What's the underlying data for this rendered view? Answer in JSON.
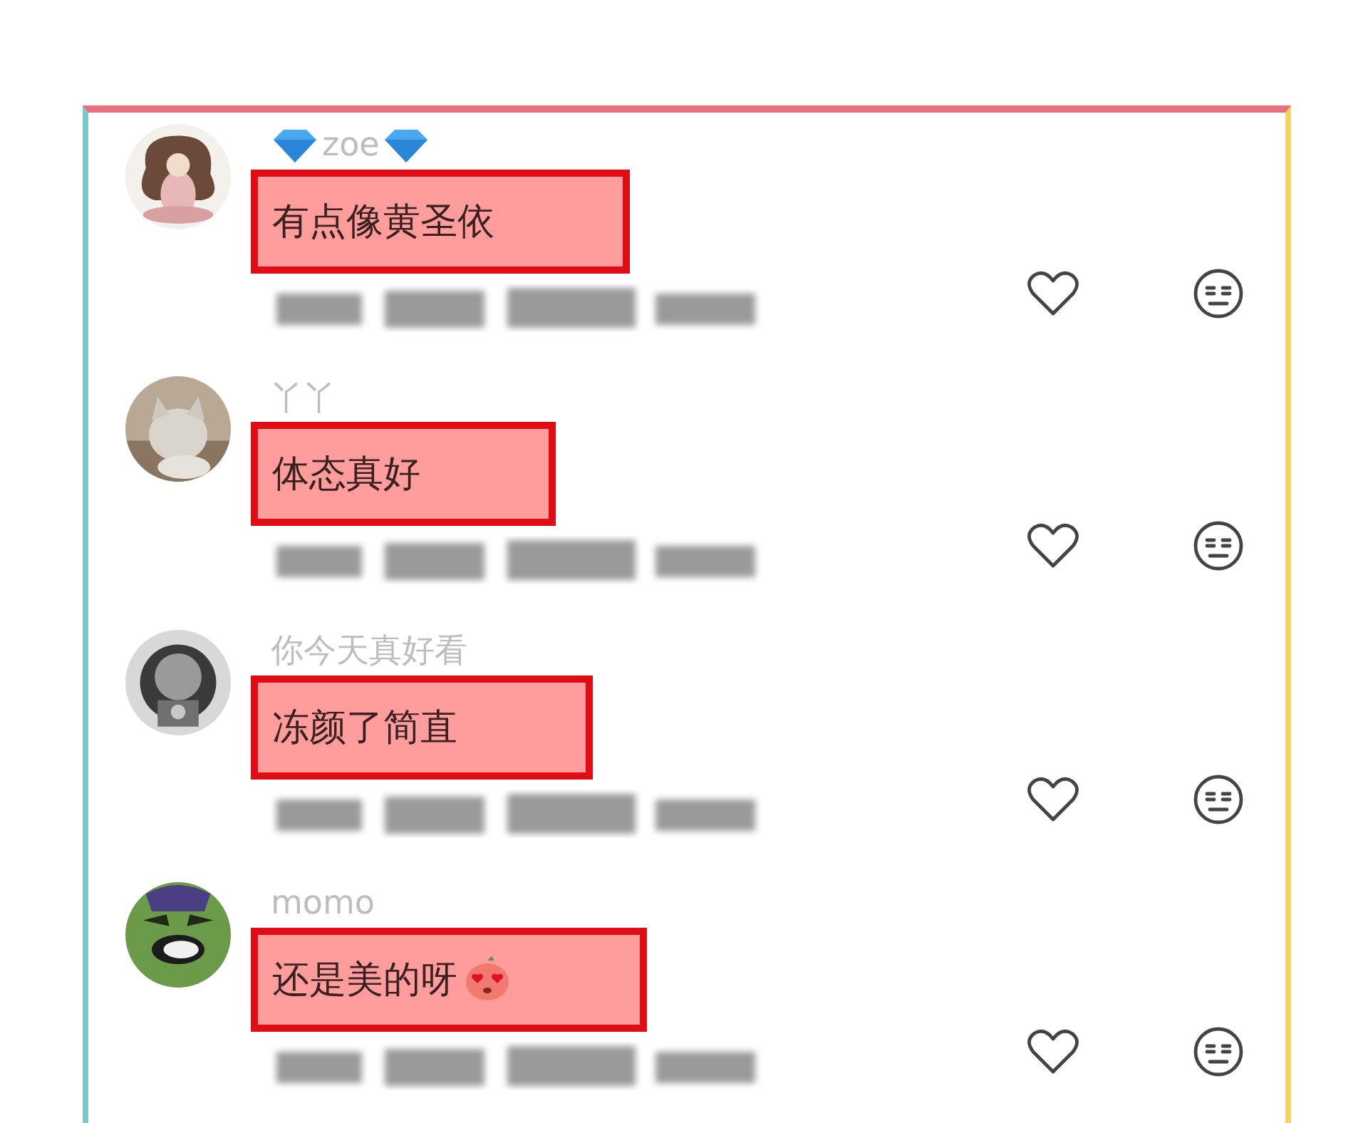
{
  "comments": [
    {
      "username": "zoe",
      "badge": true,
      "text": "有点像黄圣依",
      "highlighted": true,
      "sticker": false
    },
    {
      "username": "丫丫",
      "badge": false,
      "text": "体态真好",
      "highlighted": true,
      "sticker": false
    },
    {
      "username": "你今天真好看",
      "badge": false,
      "text": "冻颜了简直",
      "highlighted": true,
      "sticker": false
    },
    {
      "username": "momo",
      "badge": false,
      "text": "还是美的呀",
      "highlighted": true,
      "sticker": true
    }
  ]
}
